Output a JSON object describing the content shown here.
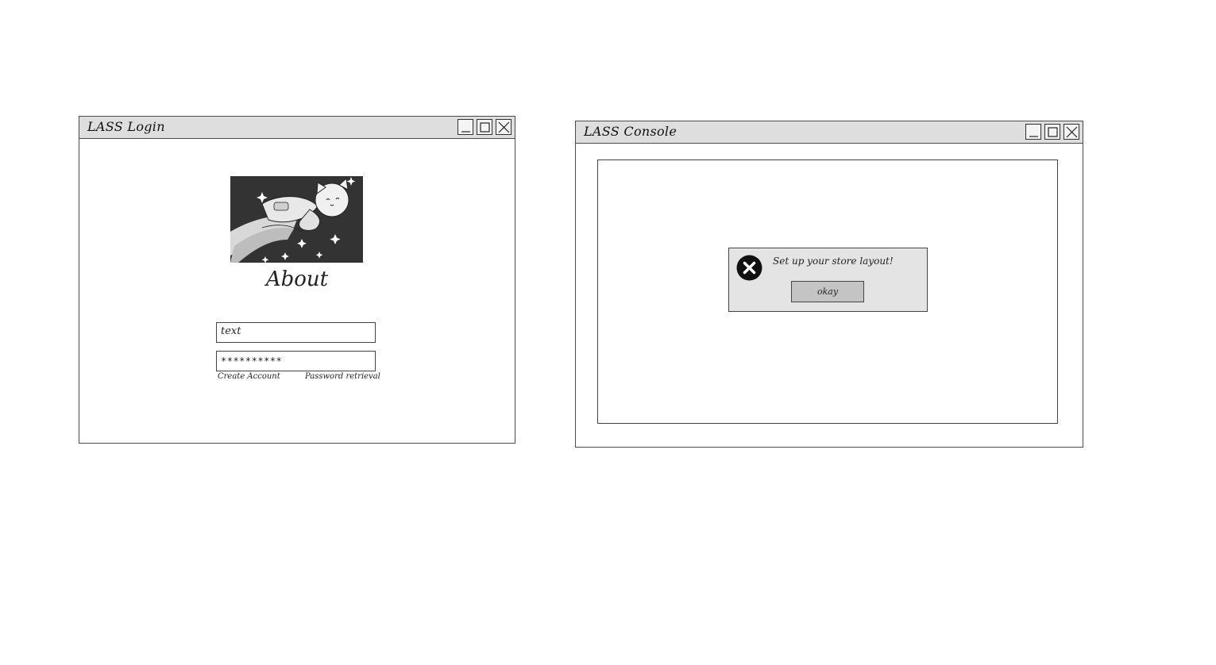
{
  "login_window": {
    "title": "LASS Login",
    "about_label": "About",
    "username": {
      "value": "text"
    },
    "password": {
      "value": "**********"
    },
    "create_account_label": "Create Account",
    "password_retrieval_label": "Password retrieval"
  },
  "console_window": {
    "title": "LASS Console",
    "alert": {
      "icon": "error-x-icon",
      "message": "Set up your store layout!",
      "ok_label": "okay"
    }
  },
  "colors": {
    "titlebar": "#dedede",
    "border": "#4a4a4a",
    "alert_bg": "#e4e4e4",
    "button_bg": "#c4c4c4"
  }
}
